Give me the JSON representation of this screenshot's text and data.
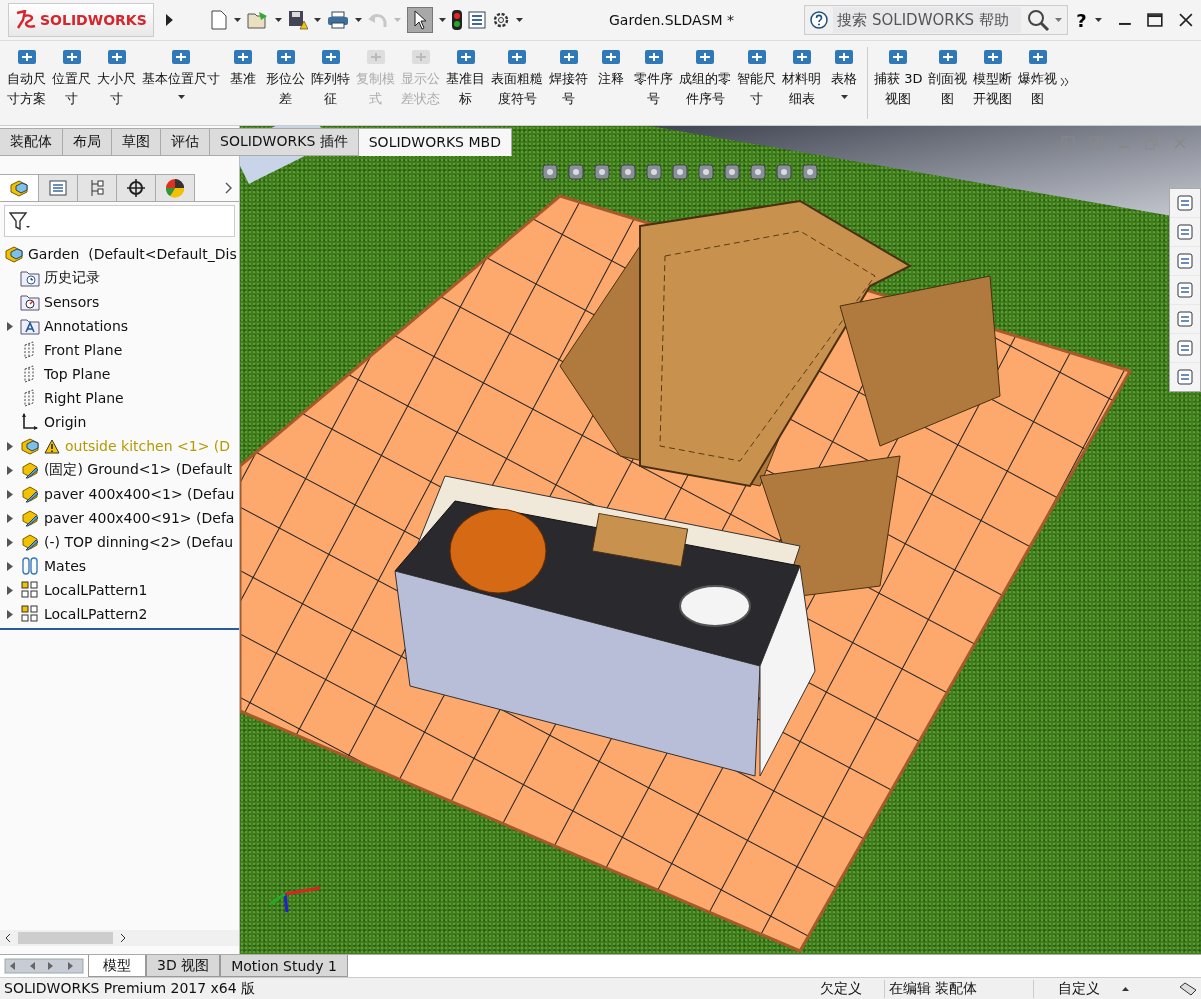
{
  "app": {
    "logo": "SOLIDWORKS",
    "title": "Garden.SLDASM *",
    "search_placeholder": "搜索 SOLIDWORKS 帮助",
    "help": "?"
  },
  "ribbon": {
    "annotate": [
      {
        "lines": [
          "自动尺",
          "寸方案"
        ],
        "disabled": false,
        "dropdown": false
      },
      {
        "lines": [
          "位置尺",
          "寸"
        ],
        "disabled": false,
        "dropdown": false
      },
      {
        "lines": [
          "大小尺",
          "寸"
        ],
        "disabled": false,
        "dropdown": false
      },
      {
        "lines": [
          "基本位置尺寸"
        ],
        "disabled": false,
        "dropdown": true
      },
      {
        "lines": [
          "基准"
        ],
        "disabled": false,
        "dropdown": false
      },
      {
        "lines": [
          "形位公",
          "差"
        ],
        "disabled": false,
        "dropdown": false
      },
      {
        "lines": [
          "阵列特",
          "征"
        ],
        "disabled": false,
        "dropdown": false
      },
      {
        "lines": [
          "复制模",
          "式"
        ],
        "disabled": true,
        "dropdown": false
      },
      {
        "lines": [
          "显示公",
          "差状态"
        ],
        "disabled": true,
        "dropdown": false
      },
      {
        "lines": [
          "基准目",
          "标"
        ],
        "disabled": false,
        "dropdown": false
      },
      {
        "lines": [
          "表面粗糙",
          "度符号"
        ],
        "disabled": false,
        "dropdown": false
      },
      {
        "lines": [
          "焊接符",
          "号"
        ],
        "disabled": false,
        "dropdown": false
      },
      {
        "lines": [
          "注释"
        ],
        "disabled": false,
        "dropdown": false
      },
      {
        "lines": [
          "零件序",
          "号"
        ],
        "disabled": false,
        "dropdown": false
      },
      {
        "lines": [
          "成组的零",
          "件序号"
        ],
        "disabled": false,
        "dropdown": false
      },
      {
        "lines": [
          "智能尺",
          "寸"
        ],
        "disabled": false,
        "dropdown": false
      },
      {
        "lines": [
          "材料明",
          "细表"
        ],
        "disabled": false,
        "dropdown": false
      },
      {
        "lines": [
          "表格"
        ],
        "disabled": false,
        "dropdown": true
      }
    ],
    "views": [
      {
        "lines": [
          "捕获 3D",
          "视图"
        ],
        "disabled": false,
        "dropdown": false
      },
      {
        "lines": [
          "剖面视",
          "图"
        ],
        "disabled": false,
        "dropdown": false
      },
      {
        "lines": [
          "模型断",
          "开视图"
        ],
        "disabled": false,
        "dropdown": false
      },
      {
        "lines": [
          "爆炸视",
          "图"
        ],
        "disabled": false,
        "dropdown": false
      }
    ]
  },
  "ribbon_tabs": [
    {
      "label": "装配体",
      "selected": false
    },
    {
      "label": "布局",
      "selected": false
    },
    {
      "label": "草图",
      "selected": false
    },
    {
      "label": "评估",
      "selected": false
    },
    {
      "label": "SOLIDWORKS 插件",
      "selected": false
    },
    {
      "label": "SOLIDWORKS MBD",
      "selected": true
    }
  ],
  "feature_tree": {
    "root": "Garden  (Default<Default_Dis",
    "children": [
      {
        "kind": "history",
        "label": "历史记录",
        "expandable": false,
        "warning": false
      },
      {
        "kind": "sensors",
        "label": "Sensors",
        "expandable": false,
        "warning": false
      },
      {
        "kind": "annotations",
        "label": "Annotations",
        "expandable": true,
        "warning": false
      },
      {
        "kind": "plane",
        "label": "Front Plane",
        "expandable": false,
        "warning": false
      },
      {
        "kind": "plane",
        "label": "Top Plane",
        "expandable": false,
        "warning": false
      },
      {
        "kind": "plane",
        "label": "Right Plane",
        "expandable": false,
        "warning": false
      },
      {
        "kind": "origin",
        "label": "Origin",
        "expandable": false,
        "warning": false
      },
      {
        "kind": "assembly",
        "label": "outside kitchen <1> (D",
        "expandable": true,
        "warning": true
      },
      {
        "kind": "part",
        "label": "(固定) Ground<1> (Default",
        "expandable": true,
        "warning": false
      },
      {
        "kind": "part",
        "label": "paver 400x400<1> (Defau",
        "expandable": true,
        "warning": false
      },
      {
        "kind": "part",
        "label": "paver 400x400<91> (Defa",
        "expandable": true,
        "warning": false
      },
      {
        "kind": "part",
        "label": "(-) TOP dinning<2> (Defau",
        "expandable": true,
        "warning": false
      },
      {
        "kind": "mates",
        "label": "Mates",
        "expandable": true,
        "warning": false
      },
      {
        "kind": "pattern",
        "label": "LocalLPattern1",
        "expandable": true,
        "warning": false
      },
      {
        "kind": "pattern",
        "label": "LocalLPattern2",
        "expandable": true,
        "warning": false
      }
    ]
  },
  "bottom_tabs": [
    {
      "label": "模型",
      "selected": true
    },
    {
      "label": "3D 视图",
      "selected": false
    },
    {
      "label": "Motion Study 1",
      "selected": false
    }
  ],
  "status_bar": [
    "SOLIDWORKS Premium 2017 x64 版",
    "欠定义",
    "在编辑 装配体",
    "自定义"
  ]
}
